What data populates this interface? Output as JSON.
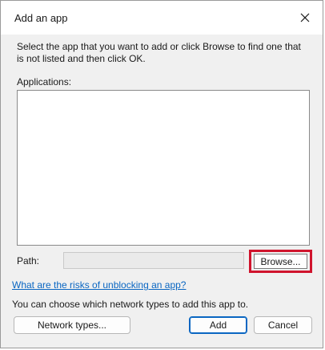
{
  "window": {
    "title": "Add an app",
    "close_icon": "close-icon"
  },
  "instructions": "Select the app that you want to add or click Browse to find one that is not listed and then click OK.",
  "applications": {
    "label": "Applications:",
    "items": []
  },
  "path": {
    "label": "Path:",
    "value": ""
  },
  "browse_label": "Browse...",
  "risk_link": "What are the risks of unblocking an app?",
  "network_note": "You can choose which network types to add this app to.",
  "buttons": {
    "network_types": "Network types...",
    "add": "Add",
    "cancel": "Cancel"
  },
  "colors": {
    "highlight": "#d0142d",
    "link": "#0a66c2",
    "accent": "#0a66c2"
  }
}
